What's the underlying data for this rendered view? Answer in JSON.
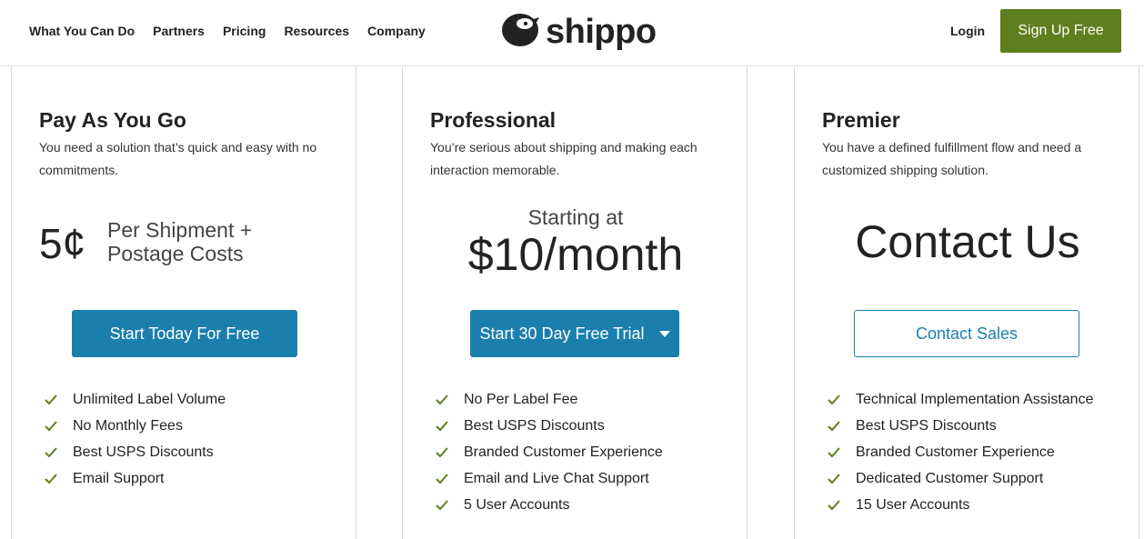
{
  "header": {
    "nav": [
      "What You Can Do",
      "Partners",
      "Pricing",
      "Resources",
      "Company"
    ],
    "logo_text": "shippo",
    "login_label": "Login",
    "signup_label": "Sign Up Free"
  },
  "colors": {
    "primary_blue": "#1b7fae",
    "brand_green": "#5e7f1e",
    "check_green": "#5e7f1e"
  },
  "plans": [
    {
      "title": "Pay As You Go",
      "description": "You need a solution that’s quick and easy with no commitments.",
      "price_amount": "5¢",
      "price_note": "Per Shipment + Postage Costs",
      "button_label": "Start Today For Free",
      "features": [
        "Unlimited Label Volume",
        "No Monthly Fees",
        "Best USPS Discounts",
        "Email Support"
      ]
    },
    {
      "title": "Professional",
      "description": "You’re serious about shipping and making each interaction memorable.",
      "price_prefix": "Starting at",
      "price_amount": "$10/month",
      "button_label": "Start 30 Day Free Trial",
      "features": [
        "No Per Label Fee",
        "Best USPS Discounts",
        "Branded Customer Experience",
        "Email and Live Chat Support",
        "5 User Accounts"
      ]
    },
    {
      "title": "Premier",
      "description": "You have a defined fulfillment flow and need a customized shipping solution.",
      "price_amount": "Contact Us",
      "button_label": "Contact Sales",
      "features": [
        "Technical Implementation Assistance",
        "Best USPS Discounts",
        "Branded Customer Experience",
        "Dedicated Customer Support",
        "15 User Accounts"
      ]
    }
  ]
}
